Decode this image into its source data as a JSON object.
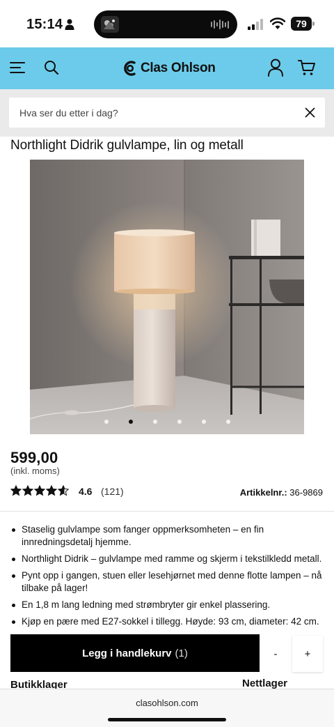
{
  "status": {
    "time": "15:14",
    "battery": "79"
  },
  "header": {
    "logo_text": "Clas Ohlson"
  },
  "search": {
    "placeholder": "Hva ser du etter i dag?"
  },
  "product": {
    "title": "Northlight Didrik gulvlampe, lin og metall",
    "price": "599,00",
    "vat_note": "(inkl. moms)",
    "rating": "4.6",
    "rating_value": 4.6,
    "review_count": "(121)",
    "article_label": "Artikkelnr.:",
    "article_number": "36-9869",
    "features": [
      "Staselig gulvlampe som fanger oppmerksomheten – en fin innredningsdetalj hjemme.",
      "Northlight Didrik – gulvlampe med ramme og skjerm i tekstilkledd metall.",
      "Pynt opp i gangen, stuen eller lesehjørnet med denne flotte lampen – nå tilbake på lager!",
      "En 1,8 m lang ledning med strømbryter gir enkel plassering.",
      "Kjøp en pære med E27-sokkel i tillegg. Høyde: 93 cm, diameter: 42 cm."
    ],
    "carousel": {
      "count": 6,
      "active_index": 2
    }
  },
  "cart_bar": {
    "add_label": "Legg i handlekurv",
    "quantity": "(1)",
    "minus": "-",
    "plus": "+"
  },
  "stock": {
    "store": "Butikklager",
    "online": "Nettlager"
  },
  "browser": {
    "url": "clasohlson.com"
  },
  "colors": {
    "header_bg": "#6ccbea",
    "button_bg": "#000000"
  },
  "icons": [
    "person-icon",
    "signal-icon",
    "wifi-icon",
    "menu-icon",
    "search-icon",
    "clas-ohlson-logo-icon",
    "account-icon",
    "cart-icon",
    "close-icon",
    "star-icon"
  ]
}
